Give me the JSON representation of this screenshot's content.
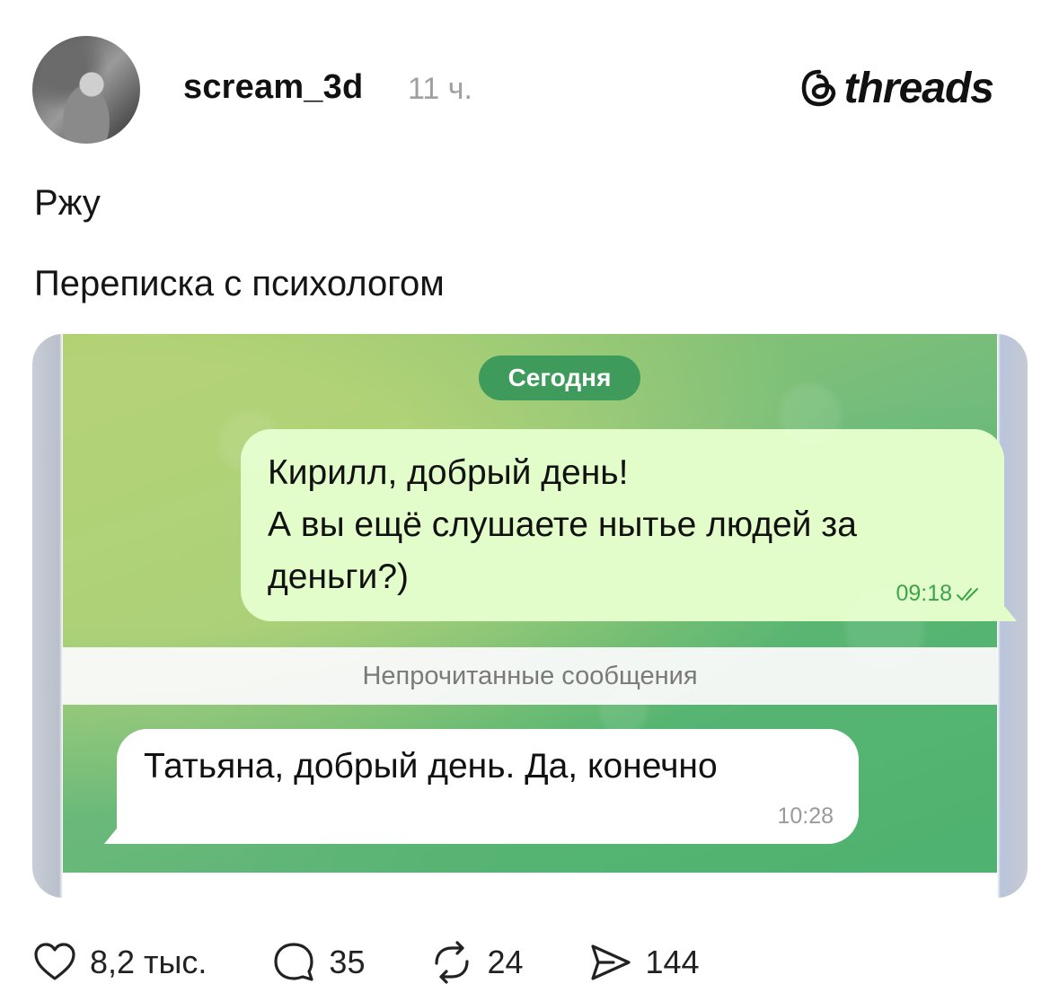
{
  "post": {
    "username": "scream_3d",
    "time_ago": "11 ч.",
    "brand": "threads",
    "text_lines": [
      "Ржу",
      "Переписка с психологом"
    ]
  },
  "chat": {
    "date_chip": "Сегодня",
    "outgoing": {
      "lines": [
        "Кирилл, добрый день!",
        "А вы ещё слушаете нытье людей за",
        "деньги?)"
      ],
      "time": "09:18",
      "status_icon": "double-check-icon"
    },
    "unread_label": "Непрочитанные сообщения",
    "incoming": {
      "text": "Татьяна, добрый день. Да, конечно",
      "time": "10:28"
    }
  },
  "actions": {
    "likes": "8,2 тыс.",
    "replies": "35",
    "reposts": "24",
    "shares": "144"
  },
  "colors": {
    "outgoing_bubble": "#e2fdc9",
    "date_chip": "#3f9b5c",
    "check_marks": "#3ba34a"
  }
}
